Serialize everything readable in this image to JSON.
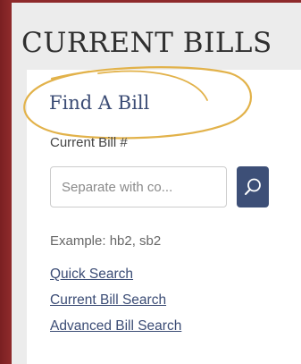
{
  "panel": {
    "title": "CURRENT BILLS"
  },
  "find_bill": {
    "heading": "Find A Bill",
    "field_label": "Current Bill #",
    "input_value": "",
    "input_placeholder": "Separate with co...",
    "search_icon": "search-icon",
    "example": "Example: hb2, sb2"
  },
  "links": {
    "quick": "Quick Search",
    "current": "Current Bill Search",
    "advanced": "Advanced Bill Search"
  },
  "colors": {
    "background": "#8e2a2b",
    "panel": "#ececec",
    "accent": "#3d4f77",
    "highlight": "#e2b24a"
  }
}
